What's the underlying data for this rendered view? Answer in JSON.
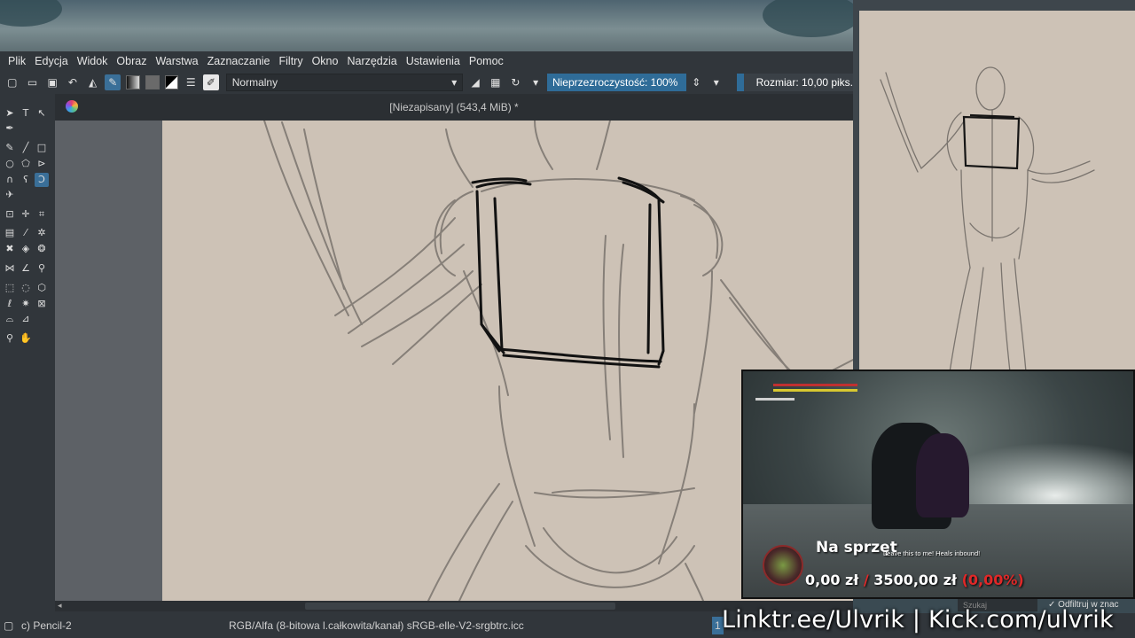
{
  "menubar": {
    "items": [
      "Plik",
      "Edycja",
      "Widok",
      "Obraz",
      "Warstwa",
      "Zaznaczanie",
      "Filtry",
      "Okno",
      "Narzędzia",
      "Ustawienia",
      "Pomoc"
    ]
  },
  "toolbar": {
    "blend_mode": "Normalny",
    "opacity": "Nieprzezroczystość: 100%",
    "size": "Rozmiar: 10,00 piks."
  },
  "document": {
    "title": "[Niezapisany]  (543,4 MiB) *"
  },
  "statusbar": {
    "brush": "c) Pencil-2",
    "color_model": "RGB/Alfa (8-bitowa l.całkowita/kanał)  sRGB-elle-V2-srgbtrc.icc",
    "layer_indicator": "1"
  },
  "overlay": {
    "donation_title": "Na sprzęt",
    "donation_current": "0,00 zł",
    "donation_separator": "/",
    "donation_goal": "3500,00 zł",
    "donation_percent": "(0,00%)",
    "chat_line": "Leave this to me! Heals inbound!",
    "brand": "Linktr.ee/Ulvrik | Kick.com/ulvrik",
    "search_placeholder": "Szukaj",
    "filter_label": "Odfiltruj w znac"
  },
  "colors": {
    "accent": "#3a6f98",
    "paper": "#cdc2b6",
    "ui_bg": "#31363b",
    "progress_red": "#e02828"
  }
}
